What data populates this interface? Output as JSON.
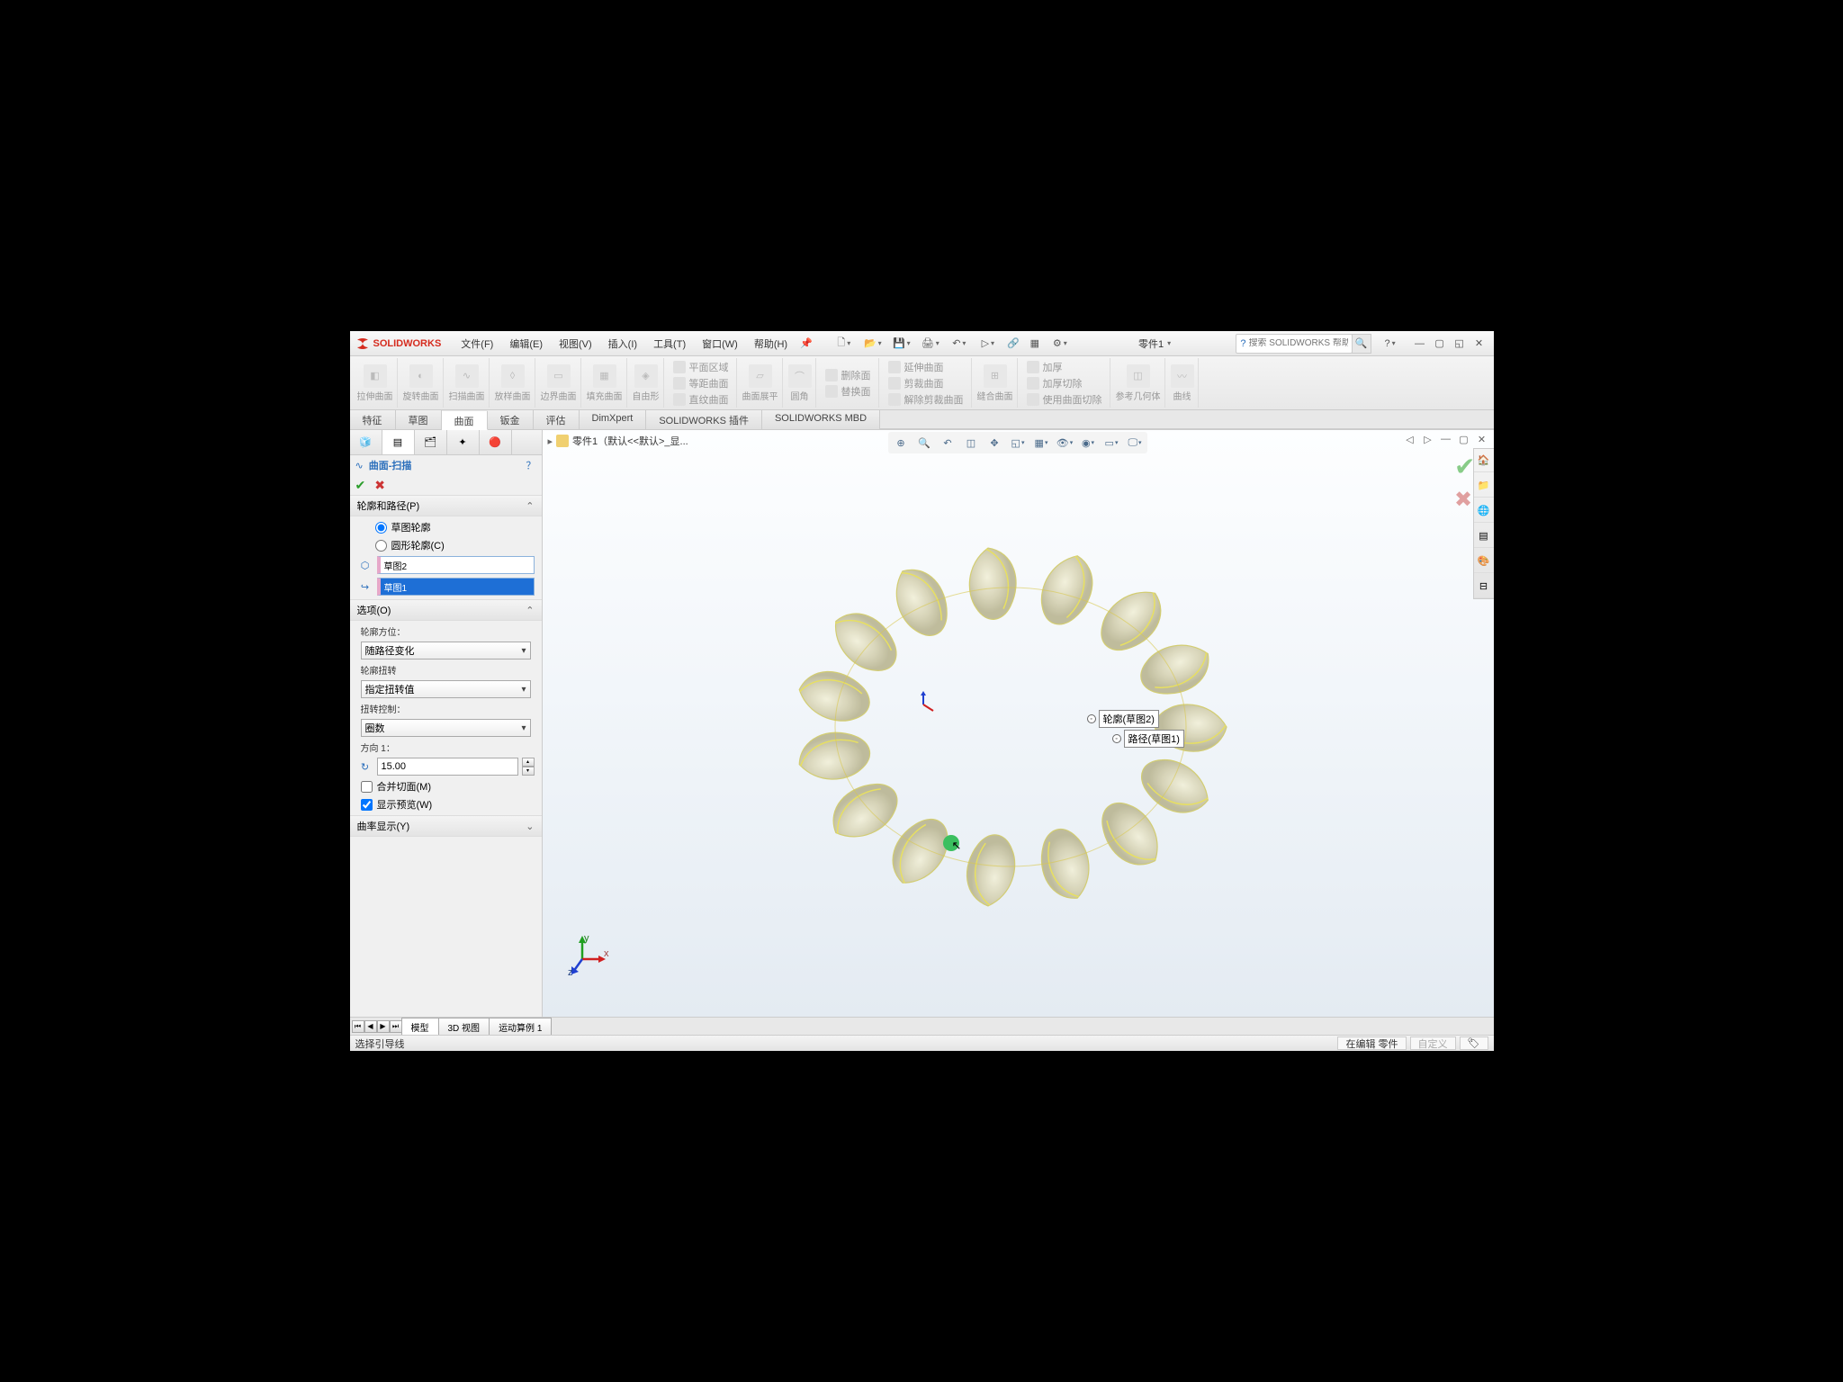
{
  "app": {
    "name": "SOLIDWORKS"
  },
  "menus": {
    "file": "文件(F)",
    "edit": "编辑(E)",
    "view": "视图(V)",
    "insert": "插入(I)",
    "tools": "工具(T)",
    "window": "窗口(W)",
    "help": "帮助(H)"
  },
  "doc": {
    "name": "零件1"
  },
  "search": {
    "placeholder": "搜索 SOLIDWORKS 帮助"
  },
  "ribbon": {
    "g1": [
      "拉伸曲面",
      "旋转曲面",
      "扫描曲面",
      "放样曲面",
      "边界曲面",
      "填充曲面",
      "自由形"
    ],
    "g2": {
      "a": "平面区域",
      "b": "等距曲面",
      "c": "直纹曲面",
      "d": "曲面展平"
    },
    "g3": "圆角",
    "g4": {
      "a": "删除面",
      "b": "替换面"
    },
    "g5": {
      "a": "延伸曲面",
      "b": "剪裁曲面",
      "c": "解除剪裁曲面"
    },
    "g6": "缝合曲面",
    "g7": {
      "a": "加厚",
      "b": "加厚切除",
      "c": "使用曲面切除"
    },
    "g8": {
      "a": "参考几何体",
      "b": "曲线"
    }
  },
  "cmd_tabs": [
    "特征",
    "草图",
    "曲面",
    "钣金",
    "评估",
    "DimXpert",
    "SOLIDWORKS 插件",
    "SOLIDWORKS MBD"
  ],
  "breadcrumb": "零件1（默认<<默认>_显...",
  "pm": {
    "title": "曲面-扫描",
    "section1": "轮廓和路径(P)",
    "radio1": "草图轮廓",
    "radio2": "圆形轮廓(C)",
    "profile": "草图2",
    "path": "草图1",
    "section2": "选项(O)",
    "opt_orient_label": "轮廓方位：",
    "opt_orient": "随路径变化",
    "opt_twist_label": "轮廓扭转",
    "opt_twist": "指定扭转值",
    "opt_twistctrl_label": "扭转控制：",
    "opt_twistctrl": "圈数",
    "dir_label": "方向 1：",
    "dir_value": "15.00",
    "chk_merge": "合并切面(M)",
    "chk_preview": "显示预览(W)",
    "section3": "曲率显示(Y)"
  },
  "callouts": {
    "profile_label": "轮廓(草图2)",
    "path_label": "路径(草图1)"
  },
  "bottom_tabs": [
    "模型",
    "3D 视图",
    "运动算例 1"
  ],
  "status": {
    "left": "选择引导线",
    "edit": "在编辑 零件",
    "custom": "自定义"
  }
}
